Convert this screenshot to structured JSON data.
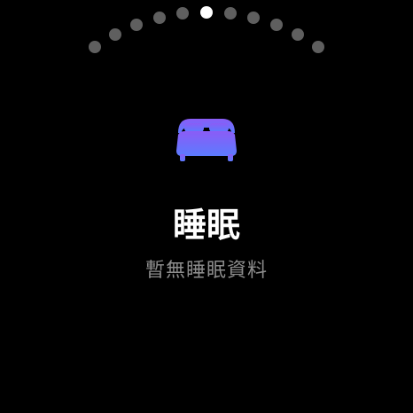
{
  "page_indicator": {
    "total": 11,
    "active_index": 5
  },
  "sleep_card": {
    "icon": "bed-icon",
    "title": "睡眠",
    "subtitle": "暫無睡眠資料"
  },
  "colors": {
    "background": "#000000",
    "dot_inactive": "#5f5f5f",
    "dot_active": "#ffffff",
    "icon_gradient_top": "#8b5cf6",
    "icon_gradient_bottom": "#5b7bff",
    "title": "#ffffff",
    "subtitle": "#8c8c8c"
  }
}
